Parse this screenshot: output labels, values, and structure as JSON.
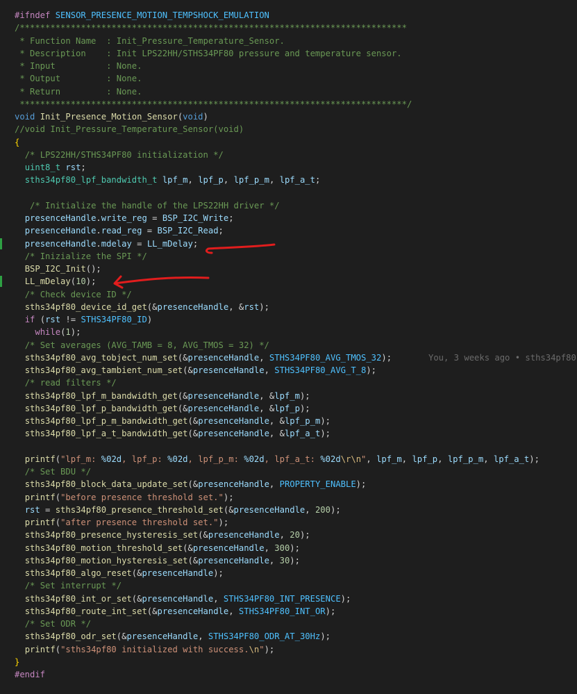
{
  "editor": {
    "blame_annotation": "You, 3 weeks ago • sths34pf80",
    "annotation_color": "#e11d1d",
    "lines": [
      {
        "indent": 0,
        "tokens": [
          {
            "t": "#ifndef",
            "c": "prep"
          },
          {
            "t": " "
          },
          {
            "t": "SENSOR_PRESENCE_MOTION_TEMPSHOCK_EMULATION",
            "c": "macro"
          }
        ]
      },
      {
        "indent": 0,
        "tokens": [
          {
            "t": "/****************************************************************************",
            "c": "comment"
          }
        ]
      },
      {
        "indent": 0,
        "tokens": [
          {
            "t": " * Function Name  : Init_Pressure_Temperature_Sensor.",
            "c": "comment"
          }
        ]
      },
      {
        "indent": 0,
        "tokens": [
          {
            "t": " * Description    : Init LPS22HH/STHS34PF80 pressure and temperature sensor.",
            "c": "comment"
          }
        ]
      },
      {
        "indent": 0,
        "tokens": [
          {
            "t": " * Input          : None.",
            "c": "comment"
          }
        ]
      },
      {
        "indent": 0,
        "tokens": [
          {
            "t": " * Output         : None.",
            "c": "comment"
          }
        ]
      },
      {
        "indent": 0,
        "tokens": [
          {
            "t": " * Return         : None.",
            "c": "comment"
          }
        ]
      },
      {
        "indent": 0,
        "tokens": [
          {
            "t": " ****************************************************************************/",
            "c": "comment"
          }
        ]
      },
      {
        "indent": 0,
        "tokens": [
          {
            "t": "void",
            "c": "keyword"
          },
          {
            "t": " "
          },
          {
            "t": "Init_Presence_Motion_Sensor",
            "c": "fn"
          },
          {
            "t": "("
          },
          {
            "t": "void",
            "c": "keyword"
          },
          {
            "t": ")"
          }
        ]
      },
      {
        "indent": 0,
        "tokens": [
          {
            "t": "//void Init_Pressure_Temperature_Sensor(void)",
            "c": "comment"
          }
        ]
      },
      {
        "indent": 0,
        "tokens": [
          {
            "t": "{",
            "c": "brace"
          }
        ]
      },
      {
        "indent": 1,
        "tokens": [
          {
            "t": "/* LPS22HH/STHS34PF80 initialization */",
            "c": "comment"
          }
        ]
      },
      {
        "indent": 1,
        "tokens": [
          {
            "t": "uint8_t",
            "c": "type"
          },
          {
            "t": " "
          },
          {
            "t": "rst",
            "c": "var"
          },
          {
            "t": ";"
          }
        ]
      },
      {
        "indent": 1,
        "tokens": [
          {
            "t": "sths34pf80_lpf_bandwidth_t",
            "c": "type"
          },
          {
            "t": " "
          },
          {
            "t": "lpf_m",
            "c": "var"
          },
          {
            "t": ", "
          },
          {
            "t": "lpf_p",
            "c": "var"
          },
          {
            "t": ", "
          },
          {
            "t": "lpf_p_m",
            "c": "var"
          },
          {
            "t": ", "
          },
          {
            "t": "lpf_a_t",
            "c": "var"
          },
          {
            "t": ";"
          }
        ]
      },
      {
        "indent": 0,
        "tokens": []
      },
      {
        "indent": 1,
        "tokens": [
          {
            "t": " /* Initialize the handle of the LPS22HH driver */",
            "c": "comment"
          }
        ]
      },
      {
        "indent": 1,
        "tokens": [
          {
            "t": "presenceHandle",
            "c": "var"
          },
          {
            "t": "."
          },
          {
            "t": "write_reg",
            "c": "var"
          },
          {
            "t": " = "
          },
          {
            "t": "BSP_I2C_Write",
            "c": "var"
          },
          {
            "t": ";"
          }
        ]
      },
      {
        "indent": 1,
        "tokens": [
          {
            "t": "presenceHandle",
            "c": "var"
          },
          {
            "t": "."
          },
          {
            "t": "read_reg",
            "c": "var"
          },
          {
            "t": " = "
          },
          {
            "t": "BSP_I2C_Read",
            "c": "var"
          },
          {
            "t": ";"
          }
        ]
      },
      {
        "indent": 1,
        "mark": true,
        "tokens": [
          {
            "t": "presenceHandle",
            "c": "var"
          },
          {
            "t": "."
          },
          {
            "t": "mdelay",
            "c": "var"
          },
          {
            "t": " = "
          },
          {
            "t": "LL_mDelay",
            "c": "var"
          },
          {
            "t": ";"
          }
        ]
      },
      {
        "indent": 1,
        "tokens": [
          {
            "t": "/* Inizialize the SPI */",
            "c": "comment"
          }
        ]
      },
      {
        "indent": 1,
        "tokens": [
          {
            "t": "BSP_I2C_Init",
            "c": "fn"
          },
          {
            "t": "();"
          }
        ]
      },
      {
        "indent": 1,
        "mark": true,
        "tokens": [
          {
            "t": "LL_mDelay",
            "c": "fn"
          },
          {
            "t": "("
          },
          {
            "t": "10",
            "c": "num"
          },
          {
            "t": ");"
          }
        ]
      },
      {
        "indent": 1,
        "tokens": [
          {
            "t": "/* Check device ID */",
            "c": "comment"
          }
        ]
      },
      {
        "indent": 1,
        "tokens": [
          {
            "t": "sths34pf80_device_id_get",
            "c": "fn"
          },
          {
            "t": "(&"
          },
          {
            "t": "presenceHandle",
            "c": "var"
          },
          {
            "t": ", &"
          },
          {
            "t": "rst",
            "c": "var"
          },
          {
            "t": ");"
          }
        ]
      },
      {
        "indent": 1,
        "tokens": [
          {
            "t": "if",
            "c": "control"
          },
          {
            "t": " ("
          },
          {
            "t": "rst",
            "c": "var"
          },
          {
            "t": " != "
          },
          {
            "t": "STHS34PF80_ID",
            "c": "macro"
          },
          {
            "t": ")"
          }
        ]
      },
      {
        "indent": 1,
        "tokens": [
          {
            "t": "  "
          },
          {
            "t": "while",
            "c": "control"
          },
          {
            "t": "("
          },
          {
            "t": "1",
            "c": "num"
          },
          {
            "t": ");"
          }
        ]
      },
      {
        "indent": 1,
        "tokens": [
          {
            "t": "/* Set averages (AVG_TAMB = 8, AVG_TMOS = 32) */",
            "c": "comment"
          }
        ]
      },
      {
        "indent": 1,
        "blame": true,
        "tokens": [
          {
            "t": "sths34pf80_avg_tobject_num_set",
            "c": "fn"
          },
          {
            "t": "(&"
          },
          {
            "t": "presenceHandle",
            "c": "var"
          },
          {
            "t": ", "
          },
          {
            "t": "STHS34PF80_AVG_TMOS_32",
            "c": "macro"
          },
          {
            "t": ");"
          }
        ]
      },
      {
        "indent": 1,
        "tokens": [
          {
            "t": "sths34pf80_avg_tambient_num_set",
            "c": "fn"
          },
          {
            "t": "(&"
          },
          {
            "t": "presenceHandle",
            "c": "var"
          },
          {
            "t": ", "
          },
          {
            "t": "STHS34PF80_AVG_T_8",
            "c": "macro"
          },
          {
            "t": ");"
          }
        ]
      },
      {
        "indent": 1,
        "tokens": [
          {
            "t": "/* read filters */",
            "c": "comment"
          }
        ]
      },
      {
        "indent": 1,
        "tokens": [
          {
            "t": "sths34pf80_lpf_m_bandwidth_get",
            "c": "fn"
          },
          {
            "t": "(&"
          },
          {
            "t": "presenceHandle",
            "c": "var"
          },
          {
            "t": ", &"
          },
          {
            "t": "lpf_m",
            "c": "var"
          },
          {
            "t": ");"
          }
        ]
      },
      {
        "indent": 1,
        "tokens": [
          {
            "t": "sths34pf80_lpf_p_bandwidth_get",
            "c": "fn"
          },
          {
            "t": "(&"
          },
          {
            "t": "presenceHandle",
            "c": "var"
          },
          {
            "t": ", &"
          },
          {
            "t": "lpf_p",
            "c": "var"
          },
          {
            "t": ");"
          }
        ]
      },
      {
        "indent": 1,
        "tokens": [
          {
            "t": "sths34pf80_lpf_p_m_bandwidth_get",
            "c": "fn"
          },
          {
            "t": "(&"
          },
          {
            "t": "presenceHandle",
            "c": "var"
          },
          {
            "t": ", &"
          },
          {
            "t": "lpf_p_m",
            "c": "var"
          },
          {
            "t": ");"
          }
        ]
      },
      {
        "indent": 1,
        "tokens": [
          {
            "t": "sths34pf80_lpf_a_t_bandwidth_get",
            "c": "fn"
          },
          {
            "t": "(&"
          },
          {
            "t": "presenceHandle",
            "c": "var"
          },
          {
            "t": ", &"
          },
          {
            "t": "lpf_a_t",
            "c": "var"
          },
          {
            "t": ");"
          }
        ]
      },
      {
        "indent": 0,
        "tokens": []
      },
      {
        "indent": 1,
        "tokens": [
          {
            "t": "printf",
            "c": "fn"
          },
          {
            "t": "("
          },
          {
            "t": "\"lpf_m: ",
            "c": "str"
          },
          {
            "t": "%02d",
            "c": "fmt"
          },
          {
            "t": ", lpf_p: ",
            "c": "str"
          },
          {
            "t": "%02d",
            "c": "fmt"
          },
          {
            "t": ", lpf_p_m: ",
            "c": "str"
          },
          {
            "t": "%02d",
            "c": "fmt"
          },
          {
            "t": ", lpf_a_t: ",
            "c": "str"
          },
          {
            "t": "%02d",
            "c": "fmt"
          },
          {
            "t": "\\r\\n",
            "c": "esc"
          },
          {
            "t": "\"",
            "c": "str"
          },
          {
            "t": ", "
          },
          {
            "t": "lpf_m",
            "c": "var"
          },
          {
            "t": ", "
          },
          {
            "t": "lpf_p",
            "c": "var"
          },
          {
            "t": ", "
          },
          {
            "t": "lpf_p_m",
            "c": "var"
          },
          {
            "t": ", "
          },
          {
            "t": "lpf_a_t",
            "c": "var"
          },
          {
            "t": ");"
          }
        ]
      },
      {
        "indent": 1,
        "tokens": [
          {
            "t": "/* Set BDU */",
            "c": "comment"
          }
        ]
      },
      {
        "indent": 1,
        "tokens": [
          {
            "t": "sths34pf80_block_data_update_set",
            "c": "fn"
          },
          {
            "t": "(&"
          },
          {
            "t": "presenceHandle",
            "c": "var"
          },
          {
            "t": ", "
          },
          {
            "t": "PROPERTY_ENABLE",
            "c": "macro"
          },
          {
            "t": ");"
          }
        ]
      },
      {
        "indent": 1,
        "tokens": [
          {
            "t": "printf",
            "c": "fn"
          },
          {
            "t": "("
          },
          {
            "t": "\"before presence threshold set.\"",
            "c": "str"
          },
          {
            "t": ");"
          }
        ]
      },
      {
        "indent": 1,
        "tokens": [
          {
            "t": "rst",
            "c": "var"
          },
          {
            "t": " = "
          },
          {
            "t": "sths34pf80_presence_threshold_set",
            "c": "fn"
          },
          {
            "t": "(&"
          },
          {
            "t": "presenceHandle",
            "c": "var"
          },
          {
            "t": ", "
          },
          {
            "t": "200",
            "c": "num"
          },
          {
            "t": ");"
          }
        ]
      },
      {
        "indent": 1,
        "tokens": [
          {
            "t": "printf",
            "c": "fn"
          },
          {
            "t": "("
          },
          {
            "t": "\"after presence threshold set.\"",
            "c": "str"
          },
          {
            "t": ");"
          }
        ]
      },
      {
        "indent": 1,
        "tokens": [
          {
            "t": "sths34pf80_presence_hysteresis_set",
            "c": "fn"
          },
          {
            "t": "(&"
          },
          {
            "t": "presenceHandle",
            "c": "var"
          },
          {
            "t": ", "
          },
          {
            "t": "20",
            "c": "num"
          },
          {
            "t": ");"
          }
        ]
      },
      {
        "indent": 1,
        "tokens": [
          {
            "t": "sths34pf80_motion_threshold_set",
            "c": "fn"
          },
          {
            "t": "(&"
          },
          {
            "t": "presenceHandle",
            "c": "var"
          },
          {
            "t": ", "
          },
          {
            "t": "300",
            "c": "num"
          },
          {
            "t": ");"
          }
        ]
      },
      {
        "indent": 1,
        "tokens": [
          {
            "t": "sths34pf80_motion_hysteresis_set",
            "c": "fn"
          },
          {
            "t": "(&"
          },
          {
            "t": "presenceHandle",
            "c": "var"
          },
          {
            "t": ", "
          },
          {
            "t": "30",
            "c": "num"
          },
          {
            "t": ");"
          }
        ]
      },
      {
        "indent": 1,
        "tokens": [
          {
            "t": "sths34pf80_algo_reset",
            "c": "fn"
          },
          {
            "t": "(&"
          },
          {
            "t": "presenceHandle",
            "c": "var"
          },
          {
            "t": ");"
          }
        ]
      },
      {
        "indent": 1,
        "tokens": [
          {
            "t": "/* Set interrupt */",
            "c": "comment"
          }
        ]
      },
      {
        "indent": 1,
        "tokens": [
          {
            "t": "sths34pf80_int_or_set",
            "c": "fn"
          },
          {
            "t": "(&"
          },
          {
            "t": "presenceHandle",
            "c": "var"
          },
          {
            "t": ", "
          },
          {
            "t": "STHS34PF80_INT_PRESENCE",
            "c": "macro"
          },
          {
            "t": ");"
          }
        ]
      },
      {
        "indent": 1,
        "tokens": [
          {
            "t": "sths34pf80_route_int_set",
            "c": "fn"
          },
          {
            "t": "(&"
          },
          {
            "t": "presenceHandle",
            "c": "var"
          },
          {
            "t": ", "
          },
          {
            "t": "STHS34PF80_INT_OR",
            "c": "macro"
          },
          {
            "t": ");"
          }
        ]
      },
      {
        "indent": 1,
        "tokens": [
          {
            "t": "/* Set ODR */",
            "c": "comment"
          }
        ]
      },
      {
        "indent": 1,
        "tokens": [
          {
            "t": "sths34pf80_odr_set",
            "c": "fn"
          },
          {
            "t": "(&"
          },
          {
            "t": "presenceHandle",
            "c": "var"
          },
          {
            "t": ", "
          },
          {
            "t": "STHS34PF80_ODR_AT_30Hz",
            "c": "macro"
          },
          {
            "t": ");"
          }
        ]
      },
      {
        "indent": 1,
        "tokens": [
          {
            "t": "printf",
            "c": "fn"
          },
          {
            "t": "("
          },
          {
            "t": "\"sths34pf80 initialized with success.",
            "c": "str"
          },
          {
            "t": "\\n",
            "c": "esc"
          },
          {
            "t": "\"",
            "c": "str"
          },
          {
            "t": ");"
          }
        ]
      },
      {
        "indent": 0,
        "tokens": [
          {
            "t": "}",
            "c": "brace"
          }
        ]
      },
      {
        "indent": 0,
        "tokens": [
          {
            "t": "#endif",
            "c": "prep"
          }
        ]
      }
    ]
  }
}
